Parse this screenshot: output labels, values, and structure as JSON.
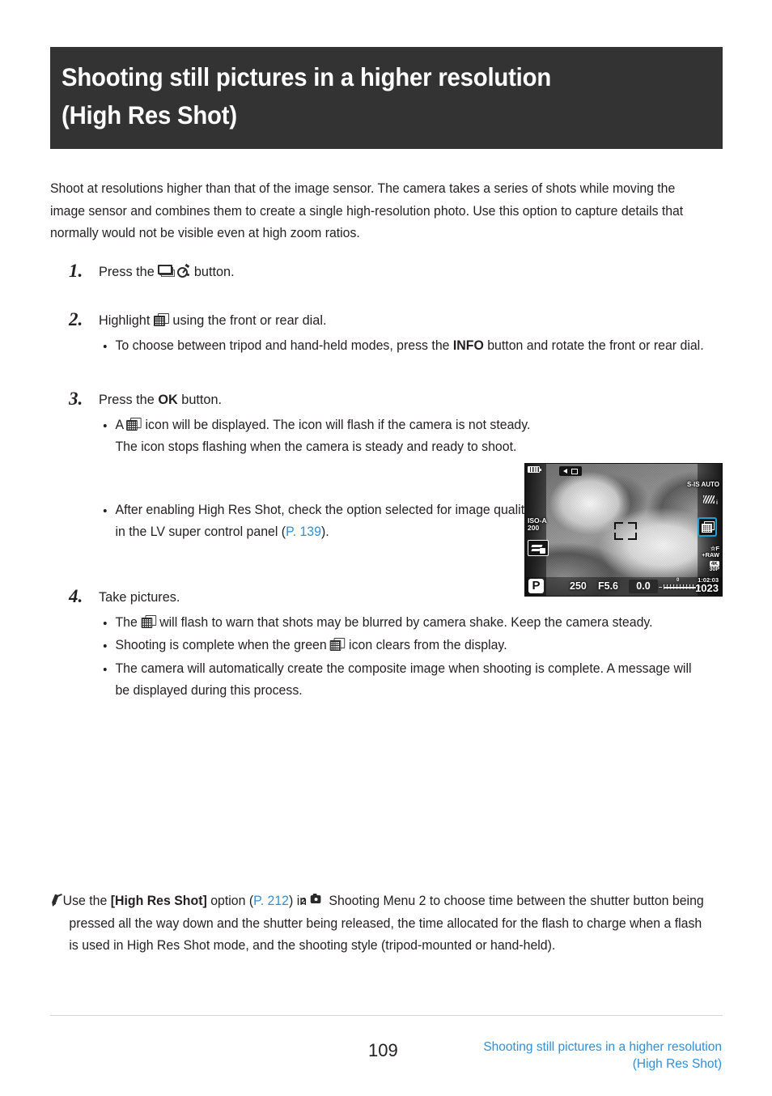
{
  "document": {
    "title_lines": [
      "Shooting still pictures in a higher resolution",
      "(High Res Shot)"
    ],
    "intro": "Shoot at resolutions higher than that of the image sensor. The camera takes a series of shots while moving the image sensor and combines them to create a single high-resolution photo. Use this option to capture details that normally would not be visible even at high zoom ratios."
  },
  "steps": [
    {
      "number": "1.",
      "head_before": "Press the ",
      "icons": [
        "sequential-shooting-icon",
        "self-timer-icon"
      ],
      "head_after": " button.",
      "bullets": []
    },
    {
      "number": "2.",
      "head_before": "Highlight ",
      "icons": [
        "high-res-shot-icon"
      ],
      "head_after": " using the front or rear dial.",
      "bullets": [
        {
          "text_1": "To choose between tripod and hand-held modes, press the ",
          "bold": "INFO",
          "text_2": " button and rotate the front or rear dial."
        }
      ]
    },
    {
      "number": "3.",
      "head_before": "Press the ",
      "head_bold": "OK",
      "head_after": " button.",
      "bullets": [
        {
          "text_1": "A ",
          "icon": "high-res-shot-icon",
          "text_2": " icon will be displayed. The icon will flash if the camera is not steady. The icon stops flashing when the camera is steady and ready to shoot."
        },
        {
          "text_1": "After enabling High Res Shot, check the option selected for image quality. Image quality can be adjusted in the LV super control panel (",
          "link": "P. 139",
          "text_2": ")."
        }
      ]
    },
    {
      "number": "4.",
      "head_before": "Take pictures.",
      "bullets": [
        {
          "text_1": "The ",
          "icon": "high-res-shot-icon",
          "text_2": " will flash to warn that shots may be blurred by camera shake. Keep the camera steady."
        },
        {
          "text_1": "Shooting is complete when the green ",
          "icon": "high-res-shot-icon",
          "text_2": " icon clears from the display."
        },
        {
          "text_1": "The camera will automatically create the composite image when shooting is complete. A message will be displayed during this process."
        }
      ]
    }
  ],
  "tip": {
    "icon": "pencil-tip-icon",
    "text_1": "Use the ",
    "bold_1": "[High Res Shot]",
    "text_2": " option (",
    "link": "P. 212",
    "text_3": ") in ",
    "menu_icon": "shooting-menu-2-icon",
    "menu_sub": "2",
    "text_4": " Shooting Menu 2 to choose time between the shutter button being pressed all the way down and the shutter being released, the time allocated for the flash to charge when a flash is used in High Res Shot mode, and the shooting style (tripod-mounted or hand-held)."
  },
  "camera_lcd": {
    "alt": "Camera live view showing a child lying in grass with a puppy",
    "battery": "battery-icon",
    "sound_indicator": "movie-sound-icon",
    "iso": "ISO-A\n200",
    "flash_mode_icon": "flash-bracket-icon",
    "stabilizer": "S-IS AUTO",
    "picture_mode": "picture-mode-icon",
    "picture_mode_sub": "i",
    "high_res_shot_indicator": "high-res-shot-indicator-icon",
    "quality": "☆F\n+RAW",
    "movie_quality_badge": "4K",
    "movie_quality": "30P",
    "exposure_mode": "P",
    "shutter_speed": "250",
    "aperture": "F5.6",
    "exposure_comp": "0.0",
    "ev_scale_minus": "–",
    "ev_scale_plus": "+",
    "ev_scale_zero": "0",
    "timecode": "1:02:03",
    "frames_remaining": "1023",
    "af_target": "af-target-brackets"
  },
  "footer": {
    "page_number": "109",
    "running_head_line1": "Shooting still pictures in a higher resolution",
    "running_head_line2": "(High Res Shot)"
  },
  "colors": {
    "banner_bg": "#333333",
    "link_blue": "#2f8fd8",
    "text": "#231f20",
    "lcd_highlight": "#1f9fd4"
  }
}
